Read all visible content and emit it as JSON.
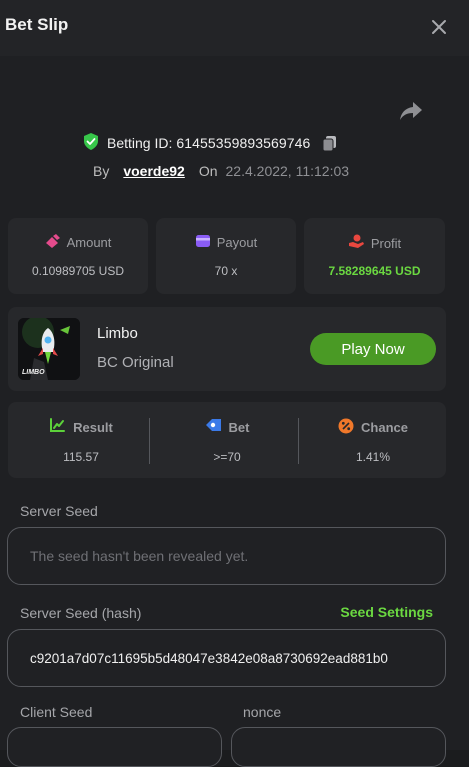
{
  "header": {
    "title": "Bet Slip",
    "close_icon": "close-icon"
  },
  "bet": {
    "id_label": "Betting ID:",
    "id_value": "61455359893569746",
    "by_label": "By",
    "user": "voerde92",
    "on_label": "On",
    "date": "22.4.2022, 11:12:03"
  },
  "stats": {
    "amount": {
      "label": "Amount",
      "value": "0.10989705 USD"
    },
    "payout": {
      "label": "Payout",
      "value": "70 x"
    },
    "profit": {
      "label": "Profit",
      "value": "7.58289645 USD"
    }
  },
  "game": {
    "name": "Limbo",
    "subtitle": "BC Original",
    "play_label": "Play Now",
    "thumb_text": "LIMBO"
  },
  "result": {
    "result": {
      "label": "Result",
      "value": "115.57"
    },
    "bet": {
      "label": "Bet",
      "value": ">=70"
    },
    "chance": {
      "label": "Chance",
      "value": "1.41%"
    }
  },
  "seeds": {
    "server_seed_label": "Server Seed",
    "server_seed_value": "The seed hasn't been revealed yet.",
    "server_hash_label": "Server Seed (hash)",
    "seed_settings_label": "Seed Settings",
    "server_hash_value": "c9201a7d07c11695b5d48047e3842e08a8730692ead881b0",
    "client_seed_label": "Client Seed",
    "nonce_label": "nonce"
  },
  "colors": {
    "accent_green": "#6bd841",
    "button_green": "#4a9a25",
    "background": "#1f2023",
    "card": "#27282b"
  }
}
